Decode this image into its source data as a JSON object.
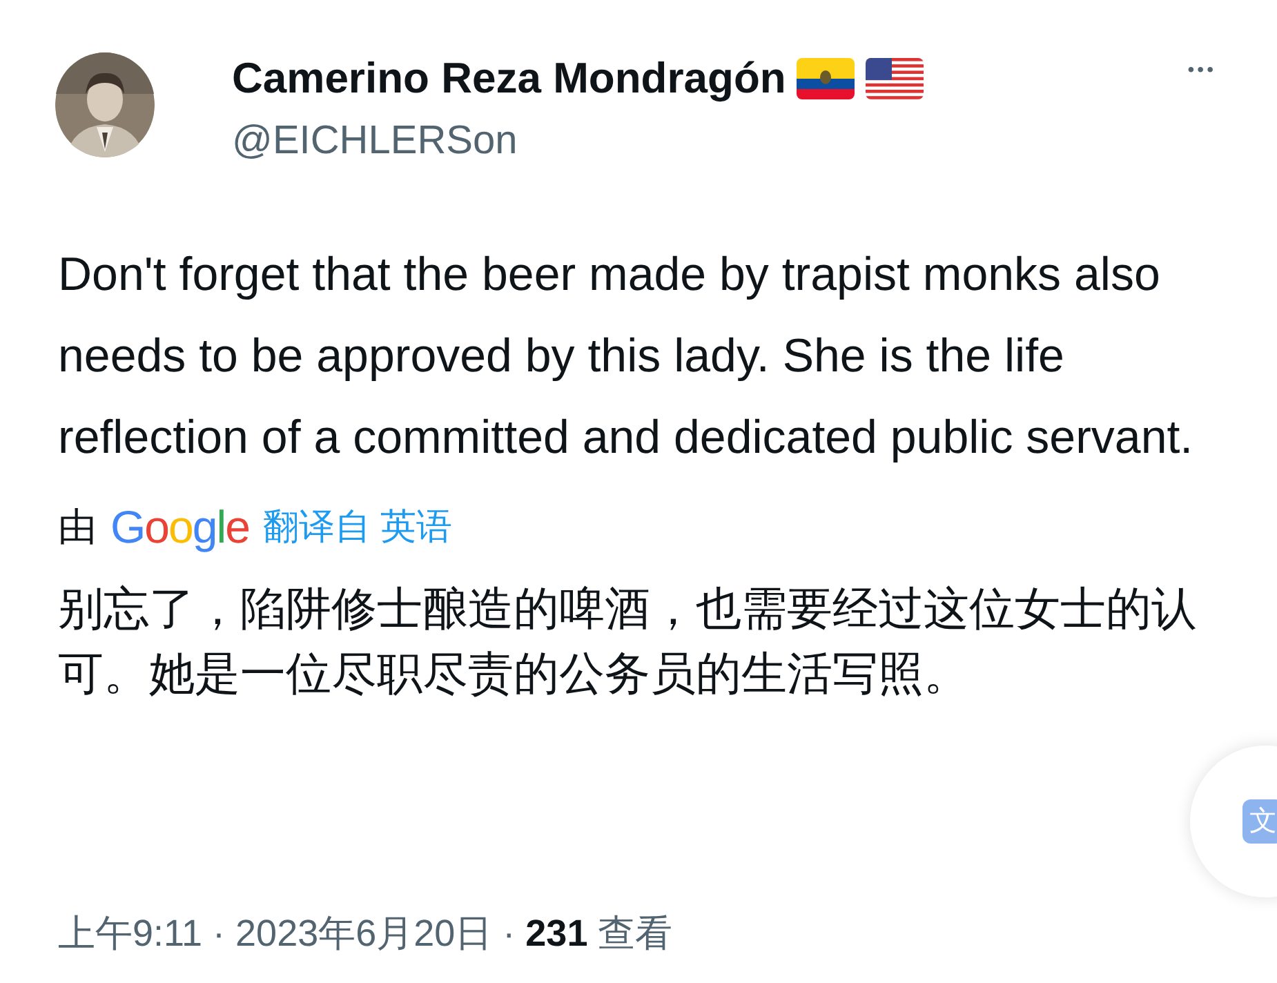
{
  "author": {
    "name": "Camerino Reza Mondragón",
    "handle": "@EICHLERSon"
  },
  "more_button": {
    "label": "•••"
  },
  "body": "Don't forget that the beer made by trapist monks also needs to be approved by this lady. She is the life reflection of a committed and dedicated public servant.",
  "translation": {
    "prefix": "由",
    "provider": "Google",
    "link": "翻译自 英语",
    "text": "别忘了，陷阱修士酿造的啤酒，也需要经过这位女士的认可。她是一位尽职尽责的公务员的生活写照。"
  },
  "translate_button": {
    "glyph": "文"
  },
  "footer": {
    "time": "上午9:11 · 2023年6月20日 · ",
    "views": "231",
    "views_label": " 查看"
  }
}
